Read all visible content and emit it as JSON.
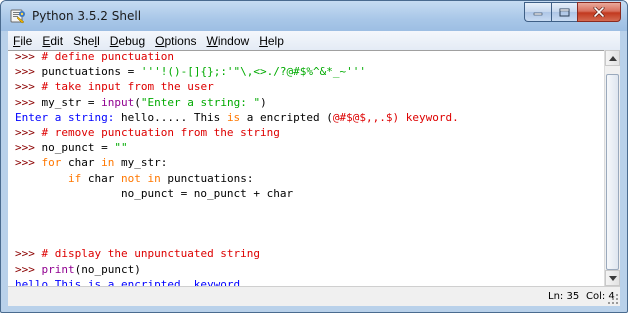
{
  "window": {
    "title": "Python 3.5.2 Shell",
    "icon": "python-idle-icon",
    "controls": [
      "minimize-icon",
      "maximize-icon",
      "close-icon"
    ]
  },
  "menu": {
    "items": [
      {
        "mnemonic": "F",
        "rest": "ile"
      },
      {
        "mnemonic": "E",
        "rest": "dit"
      },
      {
        "pre": "She",
        "mnemonic": "l",
        "rest": "l"
      },
      {
        "mnemonic": "D",
        "rest": "ebug"
      },
      {
        "mnemonic": "O",
        "rest": "ptions"
      },
      {
        "mnemonic": "W",
        "rest": "indow"
      },
      {
        "mnemonic": "H",
        "rest": "elp"
      }
    ]
  },
  "colors": {
    "prompt": "#8b0000",
    "comment": "#dd0000",
    "string": "#00aa00",
    "keyword": "#ff7700",
    "builtin": "#900090",
    "output": "#0000ff"
  },
  "shell": {
    "lines": [
      [
        {
          "t": "prompt",
          "s": ">>> "
        },
        {
          "t": "comment",
          "s": "# define punctuation"
        }
      ],
      [
        {
          "t": "prompt",
          "s": ">>> "
        },
        {
          "t": "plain",
          "s": "punctuations = "
        },
        {
          "t": "string",
          "s": "'''!()-[]{};:'\"\\,<>./?@#$%^&*_~'''"
        }
      ],
      [
        {
          "t": "prompt",
          "s": ">>> "
        },
        {
          "t": "comment",
          "s": "# take input from the user"
        }
      ],
      [
        {
          "t": "prompt",
          "s": ">>> "
        },
        {
          "t": "plain",
          "s": "my_str = "
        },
        {
          "t": "builtin",
          "s": "input"
        },
        {
          "t": "plain",
          "s": "("
        },
        {
          "t": "string",
          "s": "\"Enter a string: \""
        },
        {
          "t": "plain",
          "s": ")"
        }
      ],
      [
        {
          "t": "output",
          "s": "Enter a string: "
        },
        {
          "t": "input",
          "s": "hello..... This "
        },
        {
          "t": "keyword",
          "s": "is"
        },
        {
          "t": "input",
          "s": " a encripted "
        },
        {
          "t": "plain",
          "s": "("
        },
        {
          "t": "comment",
          "s": "@#$@$,,.$) keyword."
        }
      ],
      [
        {
          "t": "prompt",
          "s": ">>> "
        },
        {
          "t": "comment",
          "s": "# remove punctuation from the string"
        }
      ],
      [
        {
          "t": "prompt",
          "s": ">>> "
        },
        {
          "t": "plain",
          "s": "no_punct = "
        },
        {
          "t": "string",
          "s": "\"\""
        }
      ],
      [
        {
          "t": "prompt",
          "s": ">>> "
        },
        {
          "t": "keyword",
          "s": "for"
        },
        {
          "t": "plain",
          "s": " char "
        },
        {
          "t": "keyword",
          "s": "in"
        },
        {
          "t": "plain",
          "s": " my_str:"
        }
      ],
      [
        {
          "t": "plain",
          "s": "        "
        },
        {
          "t": "keyword",
          "s": "if"
        },
        {
          "t": "plain",
          "s": " char "
        },
        {
          "t": "keyword",
          "s": "not in"
        },
        {
          "t": "plain",
          "s": " punctuations:"
        }
      ],
      [
        {
          "t": "plain",
          "s": "                no_punct = no_punct + char"
        }
      ],
      [
        {
          "t": "plain",
          "s": " "
        }
      ],
      [
        {
          "t": "plain",
          "s": " "
        }
      ],
      [
        {
          "t": "plain",
          "s": " "
        }
      ],
      [
        {
          "t": "prompt",
          "s": ">>> "
        },
        {
          "t": "comment",
          "s": "# display the unpunctuated string"
        }
      ],
      [
        {
          "t": "prompt",
          "s": ">>> "
        },
        {
          "t": "builtin",
          "s": "print"
        },
        {
          "t": "plain",
          "s": "(no_punct)"
        }
      ],
      [
        {
          "t": "output",
          "s": "hello This is a encripted  keyword"
        }
      ],
      [
        {
          "t": "prompt",
          "s": ">>> "
        }
      ]
    ]
  },
  "status": {
    "line": "Ln: 35",
    "col": "Col: 4"
  },
  "scrollbar": {
    "up_icon": "scroll-up-arrow-icon",
    "down_icon": "scroll-down-arrow-icon"
  }
}
